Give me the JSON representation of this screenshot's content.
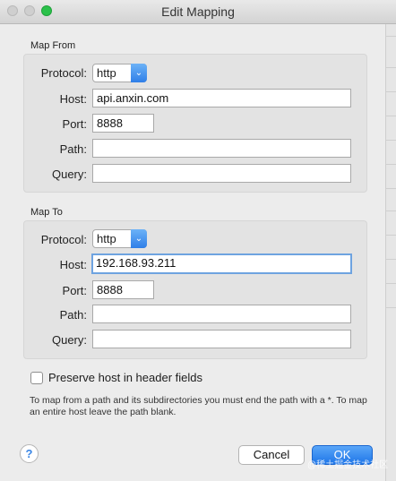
{
  "window": {
    "title": "Edit Mapping"
  },
  "map_from": {
    "heading": "Map From",
    "protocol_label": "Protocol:",
    "protocol_value": "http",
    "host_label": "Host:",
    "host_value": "api.anxin.com",
    "port_label": "Port:",
    "port_value": "8888",
    "path_label": "Path:",
    "path_value": "",
    "query_label": "Query:",
    "query_value": ""
  },
  "map_to": {
    "heading": "Map To",
    "protocol_label": "Protocol:",
    "protocol_value": "http",
    "host_label": "Host:",
    "host_value": "192.168.93.211",
    "port_label": "Port:",
    "port_value": "8888",
    "path_label": "Path:",
    "path_value": "",
    "query_label": "Query:",
    "query_value": ""
  },
  "options": {
    "preserve_host_label": "Preserve host in header fields",
    "preserve_host_checked": false
  },
  "note": "To map from a path and its subdirectories you must end the path with a *. To map an entire host leave the path blank.",
  "buttons": {
    "help": "?",
    "cancel": "Cancel",
    "ok": "OK"
  },
  "watermark": "@稀土掘金技术社区",
  "colors": {
    "accent": "#2f7fe8",
    "focus_ring": "#6ea3e0",
    "background": "#ececec"
  },
  "icons": {
    "select_chevron": "chevron-updown-icon",
    "help": "help-icon"
  }
}
